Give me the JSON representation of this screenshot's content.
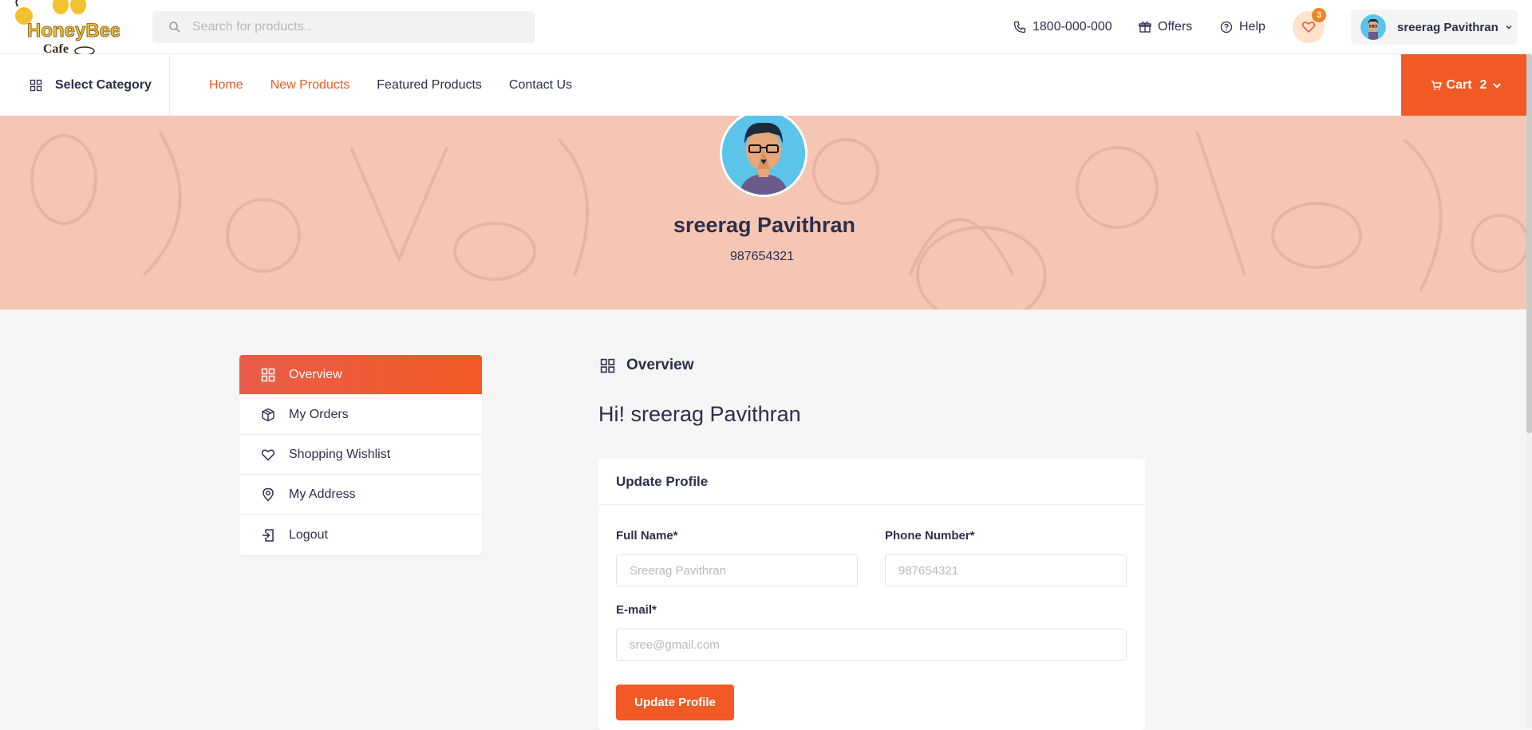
{
  "header": {
    "logo_text_1": "HoneyBee",
    "logo_text_2": "Cafe",
    "search_placeholder": "Search for products..",
    "phone": "1800-000-000",
    "offers": "Offers",
    "help": "Help",
    "wishlist_count": "3",
    "user_name": "sreerag Pavithran"
  },
  "nav": {
    "select_category": "Select Category",
    "links": [
      "Home",
      "New Products",
      "Featured Products",
      "Contact Us"
    ],
    "cart_label": "Cart",
    "cart_count": "2"
  },
  "hero": {
    "name": "sreerag Pavithran",
    "phone": "987654321"
  },
  "sidebar": {
    "items": [
      {
        "label": "Overview",
        "icon": "grid-icon"
      },
      {
        "label": "My Orders",
        "icon": "box-icon"
      },
      {
        "label": "Shopping Wishlist",
        "icon": "heart-icon"
      },
      {
        "label": "My Address",
        "icon": "map-pin-icon"
      },
      {
        "label": "Logout",
        "icon": "logout-icon"
      }
    ]
  },
  "main": {
    "section_title": "Overview",
    "greeting": "Hi! sreerag Pavithran",
    "form": {
      "title": "Update Profile",
      "full_name_label": "Full Name*",
      "full_name_placeholder": "Sreerag Pavithran",
      "phone_label": "Phone Number*",
      "phone_placeholder": "987654321",
      "email_label": "E-mail*",
      "email_placeholder": "sree@gmail.com",
      "submit_label": "Update Profile"
    }
  },
  "colors": {
    "accent": "#f15a24",
    "hero_bg": "#f6c6b5",
    "text": "#2b2f4c"
  }
}
